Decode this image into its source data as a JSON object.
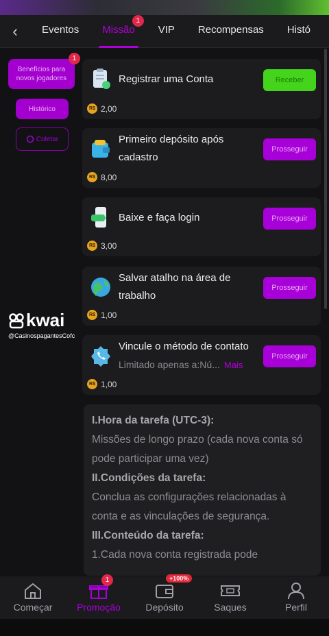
{
  "header": {
    "tabs": [
      {
        "label": "Eventos",
        "active": false
      },
      {
        "label": "Missão",
        "active": true,
        "badge": "1"
      },
      {
        "label": "VIP",
        "active": false
      },
      {
        "label": "Recompensas",
        "active": false
      },
      {
        "label": "Histó",
        "active": false
      }
    ]
  },
  "sidebar": {
    "items": [
      {
        "label": "Benefícios para novos jogadores",
        "badge": "1"
      },
      {
        "label": "Histórico"
      },
      {
        "label": "Coletar"
      }
    ]
  },
  "tasks": [
    {
      "title": "Registrar uma Conta",
      "reward": "2,00",
      "button": "Receber",
      "button_style": "green",
      "icon": "clipboard-icon"
    },
    {
      "title_line1": "Primeiro depósito após",
      "title_line2": "cadastro",
      "reward": "8,00",
      "button": "Prosseguir",
      "icon": "wallet-icon"
    },
    {
      "title": "Baixe e faça login",
      "reward": "3,00",
      "button": "Prosseguir",
      "icon": "phone-download-icon"
    },
    {
      "title_line1": "Salvar atalho na área de",
      "title_line2": "trabalho",
      "reward": "1,00",
      "button": "Prosseguir",
      "icon": "globe-icon"
    },
    {
      "title": "Vincule o método de contato",
      "subtitle": "Limitado apenas a:Nú...",
      "more": "Mais",
      "reward": "1,00",
      "button": "Prosseguir",
      "icon": "phone-badge-icon"
    }
  ],
  "currency_symbol": "R$",
  "rules": [
    {
      "text": "I.Hora da tarefa (UTC-3):",
      "heading": true
    },
    {
      "text": "Missões de longo prazo (cada nova conta só pode participar uma vez)",
      "heading": false
    },
    {
      "text": "II.Condições da tarefa:",
      "heading": true
    },
    {
      "text": "Conclua as configurações relacionadas à conta e as vinculações de segurança.",
      "heading": false
    },
    {
      "text": "III.Conteúdo da tarefa:",
      "heading": true
    },
    {
      "text": "1.Cada nova conta registrada pode",
      "heading": false
    }
  ],
  "watermark": {
    "brand": "kwai",
    "handle": "@CasinospagantesCofc"
  },
  "bottom_nav": [
    {
      "label": "Começar",
      "icon": "home-icon",
      "active": false
    },
    {
      "label": "Promoção",
      "icon": "gift-icon",
      "active": true,
      "badge": "1"
    },
    {
      "label": "Depósito",
      "icon": "wallet-icon",
      "active": false,
      "pct": "+100%"
    },
    {
      "label": "Saques",
      "icon": "ticket-icon",
      "active": false
    },
    {
      "label": "Perfil",
      "icon": "person-icon",
      "active": false
    }
  ],
  "colors": {
    "accent": "#a800d8",
    "green": "#44d41c",
    "badge": "#e0284a",
    "background": "#121214"
  }
}
